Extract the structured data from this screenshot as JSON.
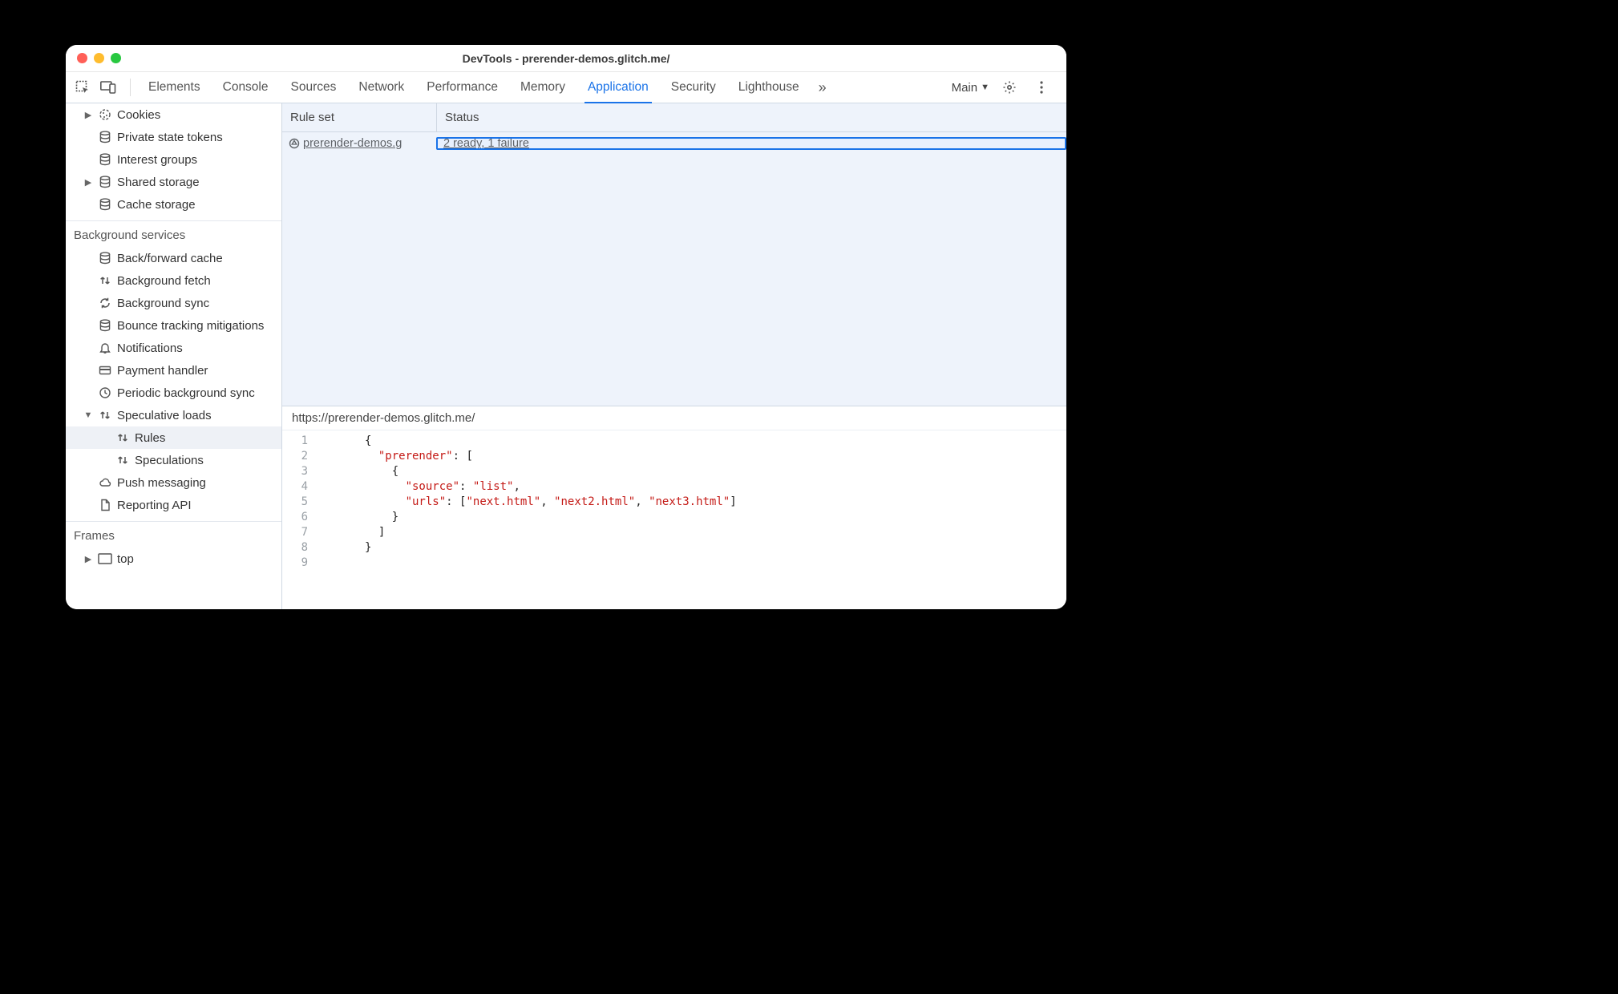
{
  "window": {
    "title": "DevTools - prerender-demos.glitch.me/"
  },
  "tabs": {
    "items": [
      "Elements",
      "Console",
      "Sources",
      "Network",
      "Performance",
      "Memory",
      "Application",
      "Security",
      "Lighthouse"
    ],
    "active_index": 6,
    "overflow_glyph": "»",
    "target_label": "Main"
  },
  "sidebar": {
    "storage_group": [
      {
        "label": "Cookies",
        "icon": "cookie",
        "chevron": "right"
      },
      {
        "label": "Private state tokens",
        "icon": "db"
      },
      {
        "label": "Interest groups",
        "icon": "db"
      },
      {
        "label": "Shared storage",
        "icon": "db",
        "chevron": "right"
      },
      {
        "label": "Cache storage",
        "icon": "db"
      }
    ],
    "bg_services_header": "Background services",
    "bg_services": [
      {
        "label": "Back/forward cache",
        "icon": "db"
      },
      {
        "label": "Background fetch",
        "icon": "updown"
      },
      {
        "label": "Background sync",
        "icon": "sync"
      },
      {
        "label": "Bounce tracking mitigations",
        "icon": "db"
      },
      {
        "label": "Notifications",
        "icon": "bell"
      },
      {
        "label": "Payment handler",
        "icon": "card"
      },
      {
        "label": "Periodic background sync",
        "icon": "clock"
      },
      {
        "label": "Speculative loads",
        "icon": "updown",
        "chevron": "down",
        "children": [
          {
            "label": "Rules",
            "icon": "updown",
            "selected": true
          },
          {
            "label": "Speculations",
            "icon": "updown"
          }
        ]
      },
      {
        "label": "Push messaging",
        "icon": "cloud"
      },
      {
        "label": "Reporting API",
        "icon": "doc"
      }
    ],
    "frames_header": "Frames",
    "frames": [
      {
        "label": "top",
        "icon": "frame",
        "chevron": "right"
      }
    ]
  },
  "table": {
    "headers": [
      "Rule set",
      "Status"
    ],
    "rows": [
      {
        "ruleset": " prerender-demos.g",
        "status": "2 ready, 1 failure",
        "selected_col": 1
      }
    ]
  },
  "details": {
    "url": "https://prerender-demos.glitch.me/",
    "json": {
      "prerender": [
        {
          "source": "list",
          "urls": [
            "next.html",
            "next2.html",
            "next3.html"
          ]
        }
      ]
    },
    "line_count": 9
  }
}
